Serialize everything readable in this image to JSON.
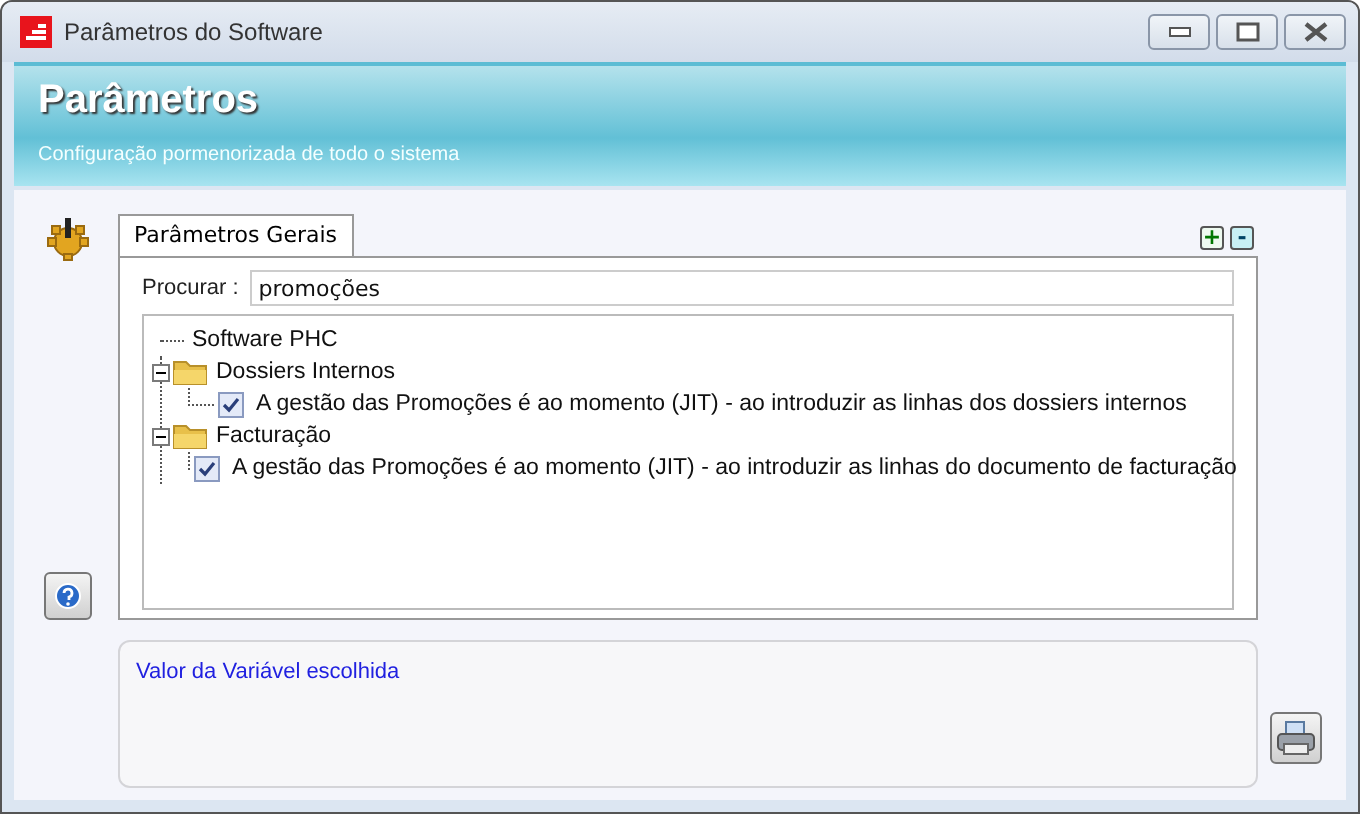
{
  "window": {
    "title": "Parâmetros do Software"
  },
  "header": {
    "title": "Parâmetros",
    "subtitle": "Configuração pormenorizada de todo o sistema"
  },
  "tabs": [
    {
      "label": "Parâmetros Gerais",
      "selected": true
    }
  ],
  "expand_all": "+",
  "collapse_all": "-",
  "search": {
    "label": "Procurar :",
    "value": "promoções"
  },
  "tree": [
    {
      "kind": "root",
      "label": "Software PHC",
      "children": [
        {
          "kind": "folder",
          "label": "Dossiers Internos",
          "expanded": true,
          "children": [
            {
              "kind": "setting",
              "label": "A gestão das Promoções é ao momento (JIT) - ao introduzir as linhas dos dossiers internos",
              "checked": true
            }
          ]
        },
        {
          "kind": "folder",
          "label": "Facturação",
          "expanded": true,
          "children": [
            {
              "kind": "setting",
              "label": "A gestão das Promoções é ao momento (JIT) - ao introduzir as linhas do documento de facturação",
              "checked": true
            }
          ]
        }
      ]
    }
  ],
  "value_panel": {
    "label": "Valor da Variável escolhida"
  }
}
